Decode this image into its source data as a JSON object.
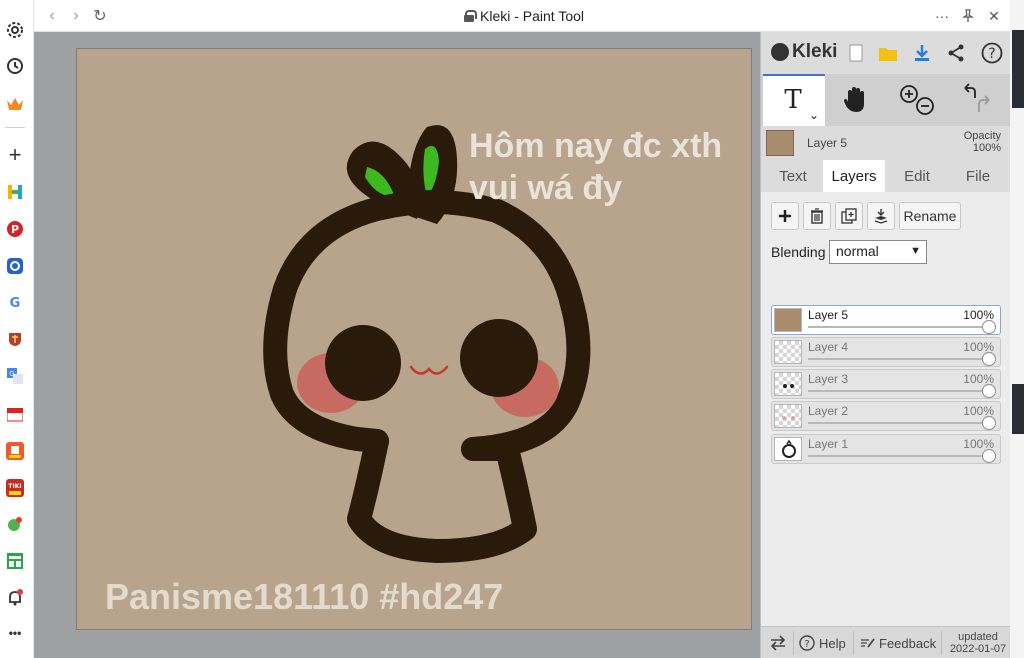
{
  "browser": {
    "title": "Kleki - Paint Tool",
    "nav": {
      "back": "‹",
      "forward": "›",
      "reload": "↻"
    },
    "controls": {
      "more": "···",
      "pin": "📌",
      "close": "✕"
    },
    "sidebar_icons": [
      "gear-icon",
      "history-icon",
      "crown-icon",
      "add-icon",
      "h-app-icon",
      "pinterest-icon",
      "app-icon",
      "google-icon",
      "shield-app-icon",
      "translate-icon",
      "shop-icon",
      "tet-icon",
      "tiki-icon",
      "paint-icon",
      "sheet-icon",
      "bell-icon",
      "more-icon"
    ],
    "sidebar_more": "•••",
    "sidebar_add": "+"
  },
  "canvas": {
    "text_line1": "Hôm nay đc xth",
    "text_line2": "vui wá đy",
    "watermark": "Panisme181110 #hd247",
    "bg_color": "#b8a48c"
  },
  "panel": {
    "logo": "Kleki",
    "current_layer": {
      "name": "Layer 5",
      "opacity_label": "Opacity",
      "opacity_value": "100%"
    },
    "tabs": [
      {
        "label": "Text"
      },
      {
        "label": "Layers"
      },
      {
        "label": "Edit"
      },
      {
        "label": "File"
      }
    ],
    "active_tab": "Layers",
    "layer_buttons": {
      "rename": "Rename"
    },
    "blending": {
      "label": "Blending",
      "value": "normal"
    },
    "layers": [
      {
        "name": "Layer 5",
        "opacity": "100%",
        "opacity_value": 1.0
      },
      {
        "name": "Layer 4",
        "opacity": "100%",
        "opacity_value": 1.0
      },
      {
        "name": "Layer 3",
        "opacity": "100%",
        "opacity_value": 1.0
      },
      {
        "name": "Layer 2",
        "opacity": "100%",
        "opacity_value": 1.0
      },
      {
        "name": "Layer 1",
        "opacity": "100%",
        "opacity_value": 1.0
      }
    ],
    "footer": {
      "help": "Help",
      "feedback": "Feedback",
      "updated_label": "updated",
      "updated_date": "2022-01-07"
    }
  }
}
